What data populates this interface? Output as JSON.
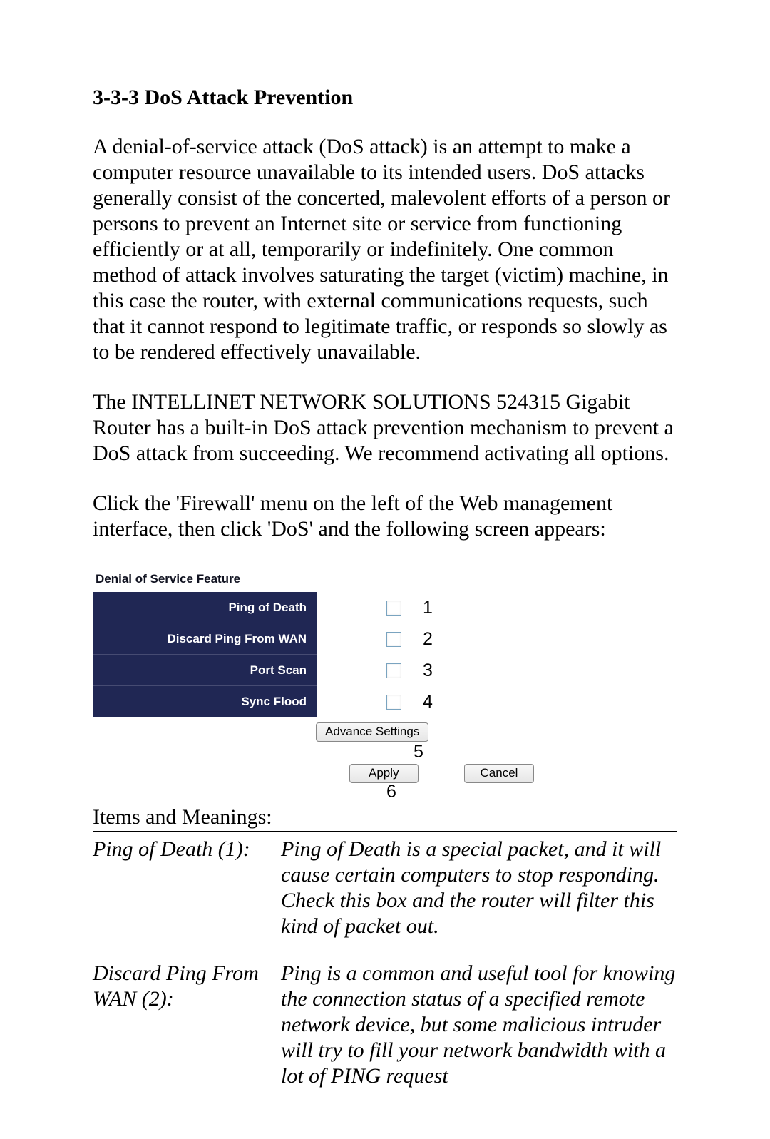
{
  "heading": "3-3-3 DoS Attack Prevention",
  "para1": "A denial-of-service attack (DoS attack) is an attempt to make a computer resource unavailable to its intended users. DoS attacks generally consist of the concerted, malevolent efforts of a person or persons to prevent an Internet site or service from functioning efficiently or at all, temporarily or indefinitely. One common method of attack involves saturating the target (victim) machine, in this case the router, with external communications requests, such that it cannot respond to legitimate traffic, or responds so slowly as to be rendered effectively unavailable.",
  "para2": "The INTELLINET NETWORK SOLUTIONS 524315 Gigabit Router has a built-in DoS attack prevention mechanism to prevent a DoS attack from succeeding. We recommend activating all options.",
  "para3": "Click the 'Firewall' menu on the left of the Web management interface, then click 'DoS' and the following screen appears:",
  "panel": {
    "title": "Denial of Service Feature",
    "rows": [
      {
        "label": "Ping of Death",
        "num": "1"
      },
      {
        "label": "Discard Ping From WAN",
        "num": "2"
      },
      {
        "label": "Port Scan",
        "num": "3"
      },
      {
        "label": "Sync Flood",
        "num": "4"
      }
    ],
    "advance_btn": "Advance Settings",
    "num5": "5",
    "apply_btn": "Apply",
    "cancel_btn": "Cancel",
    "num6": "6"
  },
  "items_heading": "Items and Meanings:",
  "defs": [
    {
      "term": "Ping of Death (1):",
      "desc": "Ping of Death is a special packet, and it will cause certain computers to stop responding. Check this box and the router will filter this kind of packet out."
    },
    {
      "term": "Discard Ping From WAN (2):",
      "desc": "Ping is a common and useful tool for knowing the connection status of a specified remote network device, but some malicious intruder will try to fill your network bandwidth with a lot of PING request"
    }
  ]
}
